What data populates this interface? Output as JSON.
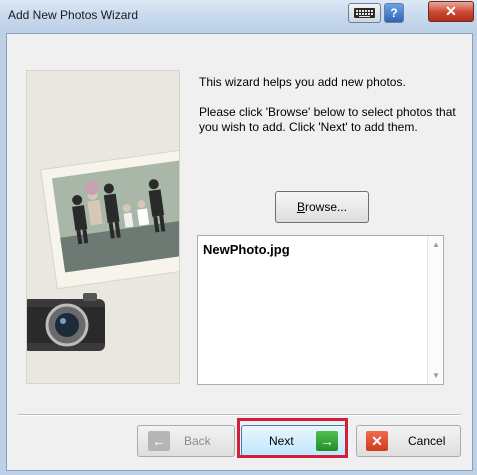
{
  "window": {
    "title": "Add New Photos Wizard",
    "help_label": "?",
    "close_label": "✕"
  },
  "content": {
    "intro": "This wizard helps you add new photos.",
    "instructions": "Please click 'Browse' below to select photos that you wish to add. Click 'Next' to add them.",
    "browse_label": "Browse...",
    "files": [
      "NewPhoto.jpg"
    ]
  },
  "buttons": {
    "back_label": "Back",
    "next_label": "Next",
    "cancel_label": "Cancel"
  },
  "icons": {
    "keyboard": "keyboard-icon",
    "help": "help-icon",
    "close": "close-icon",
    "back": "back-arrow-icon",
    "next": "next-arrow-icon",
    "cancel": "cancel-x-icon"
  },
  "colors": {
    "highlight": "#d31f3b",
    "next_icon": "#2e9a2e",
    "cancel_icon": "#e0472a"
  }
}
